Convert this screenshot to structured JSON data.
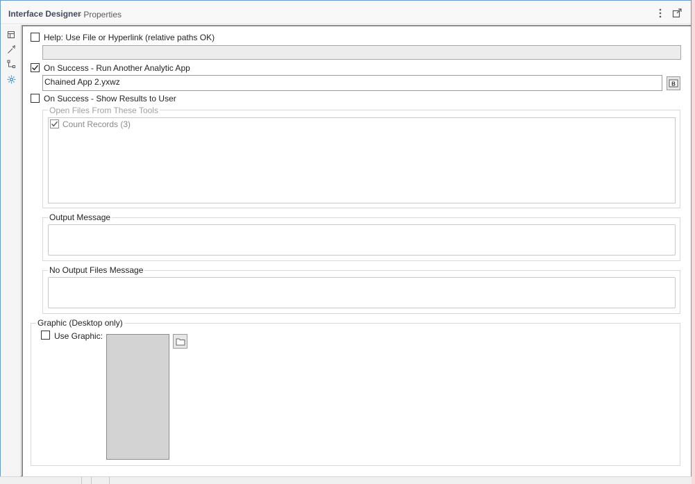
{
  "titlebar": {
    "title": "Interface Designer",
    "subtitle": "- Properties"
  },
  "leftbar": {
    "items": [
      {
        "icon": "layout-icon"
      },
      {
        "icon": "wand-icon"
      },
      {
        "icon": "tree-icon"
      },
      {
        "icon": "gear-icon",
        "active": true
      }
    ]
  },
  "properties": {
    "help": {
      "label": "Help: Use File or Hyperlink (relative paths OK)",
      "checked": false,
      "value": ""
    },
    "run_app": {
      "label": "On Success - Run Another Analytic App",
      "checked": true,
      "value": "Chained App 2.yxwz"
    },
    "show_results": {
      "label": "On Success - Show Results to User",
      "checked": false,
      "open_files_legend": "Open Files From These Tools",
      "tools": [
        {
          "label": "Count Records (3)",
          "checked": true
        }
      ],
      "output_message_legend": "Output Message",
      "output_message": "",
      "no_output_legend": "No Output Files Message",
      "no_output_message": ""
    },
    "graphic": {
      "legend": "Graphic (Desktop only)",
      "use_label": "Use Graphic:",
      "checked": false
    }
  },
  "colors": {
    "accent": "#6a9ac9",
    "active_icon": "#2f7fc1"
  }
}
